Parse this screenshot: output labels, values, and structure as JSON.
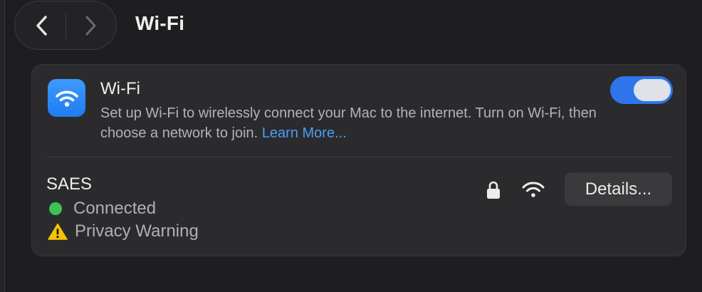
{
  "header": {
    "title": "Wi-Fi",
    "back_icon": "chevron-left-icon",
    "forward_icon": "chevron-right-icon"
  },
  "wifi_panel": {
    "title": "Wi-Fi",
    "description": "Set up Wi-Fi to wirelessly connect your Mac to the internet. Turn on Wi-Fi, then choose a network to join.",
    "learn_more_label": "Learn More...",
    "icon": "wifi-icon",
    "toggle_state": "on",
    "accent_color": "#2f74ea"
  },
  "network": {
    "name": "SAES",
    "status": "Connected",
    "status_color": "#3fc156",
    "warning": "Privacy Warning",
    "warning_color": "#f5c400",
    "secured_icon": "lock-icon",
    "signal_icon": "wifi-signal-icon",
    "details_label": "Details..."
  }
}
